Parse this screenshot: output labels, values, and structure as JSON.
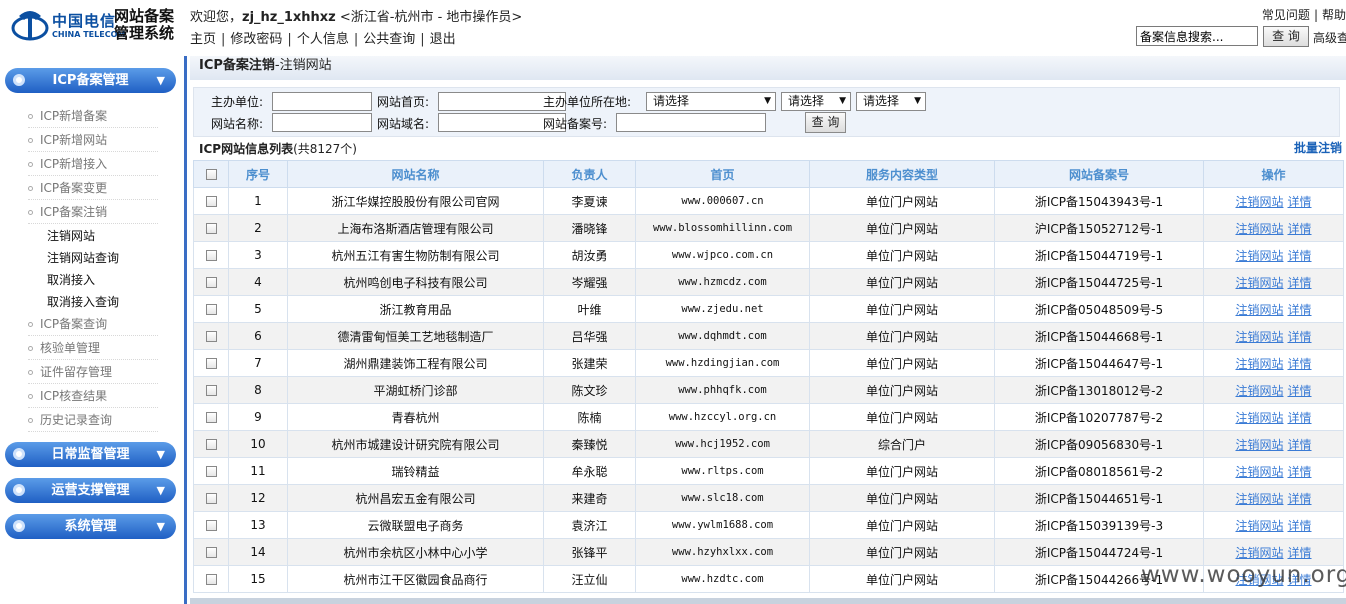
{
  "header": {
    "logo_cn": "中国电信",
    "logo_en": "CHINA TELECOM",
    "system_line1": "网站备案",
    "system_line2": "管理系统",
    "welcome_prefix": "欢迎您，",
    "username": "zj_hz_1xhhxz",
    "role": " <浙江省-杭州市 - 地市操作员>",
    "nav": [
      "主页",
      "修改密码",
      "个人信息",
      "公共查询",
      "退出"
    ],
    "faq": "常见问题",
    "help": "帮助",
    "search_value": "备案信息搜索...",
    "search_button": "查 询",
    "advanced_search": "高级查询"
  },
  "sidebar": {
    "groups": [
      {
        "label": "ICP备案管理",
        "icon": "chevron-down-icon"
      },
      {
        "label": "日常监督管理",
        "icon": "chevron-down-icon"
      },
      {
        "label": "运营支撑管理",
        "icon": "chevron-down-icon"
      },
      {
        "label": "系统管理",
        "icon": "chevron-down-icon"
      }
    ],
    "items": [
      "ICP新增备案",
      "ICP新增网站",
      "ICP新增接入",
      "ICP备案变更",
      "ICP备案注销",
      "ICP备案查询",
      "核验单管理",
      "证件留存管理",
      "ICP核查结果",
      "历史记录查询"
    ],
    "sub_items": [
      "注销网站",
      "注销网站查询",
      "取消接入",
      "取消接入查询"
    ]
  },
  "main": {
    "title_bold": "ICP备案注销",
    "title_rest": "-注销网站",
    "filters": {
      "sponsor_label": "主办单位:",
      "homepage_label": "网站首页:",
      "location_label": "主办单位所在地:",
      "select1": "请选择",
      "select2": "请选择",
      "select3": "请选择",
      "site_name_label": "网站名称:",
      "domain_label": "网站域名:",
      "record_no_label": "网站备案号:",
      "query_button": "查 询"
    },
    "list_title": "ICP网站信息列表",
    "list_count": "(共8127个)",
    "batch_cancel": "批量注销",
    "columns": [
      "序号",
      "网站名称",
      "负责人",
      "首页",
      "服务内容类型",
      "网站备案号",
      "操作"
    ],
    "op_cancel": "注销网站",
    "op_detail": "详情",
    "rows": [
      [
        "1",
        "浙江华媒控股股份有限公司官网",
        "李夏谏",
        "www.000607.cn",
        "单位门户网站",
        "浙ICP备15043943号-1"
      ],
      [
        "2",
        "上海布洛斯酒店管理有限公司",
        "潘晓锋",
        "www.blossomhillinn.com",
        "单位门户网站",
        "沪ICP备15052712号-1"
      ],
      [
        "3",
        "杭州五江有害生物防制有限公司",
        "胡汝勇",
        "www.wjpco.com.cn",
        "单位门户网站",
        "浙ICP备15044719号-1"
      ],
      [
        "4",
        "杭州鸣创电子科技有限公司",
        "岑耀强",
        "www.hzmcdz.com",
        "单位门户网站",
        "浙ICP备15044725号-1"
      ],
      [
        "5",
        "浙江教育用品",
        "叶维",
        "www.zjedu.net",
        "单位门户网站",
        "浙ICP备05048509号-5"
      ],
      [
        "6",
        "德清雷甸恒美工艺地毯制造厂",
        "吕华强",
        "www.dqhmdt.com",
        "单位门户网站",
        "浙ICP备15044668号-1"
      ],
      [
        "7",
        "湖州鼎建装饰工程有限公司",
        "张建荣",
        "www.hzdingjian.com",
        "单位门户网站",
        "浙ICP备15044647号-1"
      ],
      [
        "8",
        "平湖虹桥门诊部",
        "陈文珍",
        "www.phhqfk.com",
        "单位门户网站",
        "浙ICP备13018012号-2"
      ],
      [
        "9",
        "青春杭州",
        "陈楠",
        "www.hzccyl.org.cn",
        "单位门户网站",
        "浙ICP备10207787号-2"
      ],
      [
        "10",
        "杭州市城建设计研究院有限公司",
        "秦臻悦",
        "www.hcj1952.com",
        "综合门户",
        "浙ICP备09056830号-1"
      ],
      [
        "11",
        "瑞铃精益",
        "牟永聪",
        "www.rltps.com",
        "单位门户网站",
        "浙ICP备08018561号-2"
      ],
      [
        "12",
        "杭州昌宏五金有限公司",
        "来建奇",
        "www.slc18.com",
        "单位门户网站",
        "浙ICP备15044651号-1"
      ],
      [
        "13",
        "云微联盟电子商务",
        "袁济江",
        "www.ywlm1688.com",
        "单位门户网站",
        "浙ICP备15039139号-3"
      ],
      [
        "14",
        "杭州市余杭区小林中心小学",
        "张锋平",
        "www.hzyhxlxx.com",
        "单位门户网站",
        "浙ICP备15044724号-1"
      ],
      [
        "15",
        "杭州市江干区徽园食品商行",
        "汪立仙",
        "www.hzdtc.com",
        "单位门户网站",
        "浙ICP备15044266号-1"
      ]
    ]
  },
  "watermark": "www.wooyun.org"
}
